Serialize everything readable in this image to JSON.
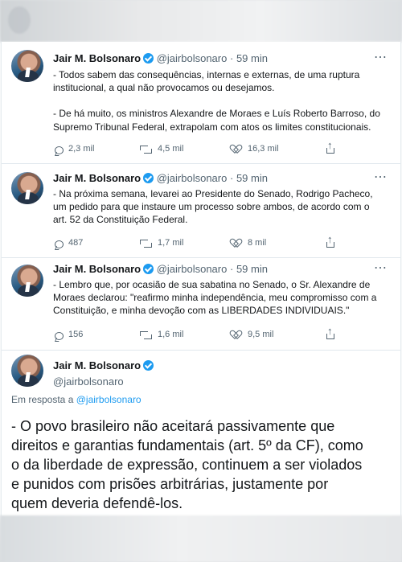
{
  "tweets": [
    {
      "author": "Jair M. Bolsonaro",
      "handle": "@jairbolsonaro",
      "separator": "·",
      "time": "59 min",
      "lines": [
        "- Todos sabem das consequências, internas e externas, de uma ruptura",
        "institucional, a qual não provocamos ou desejamos.",
        "",
        "- De há muito, os ministros Alexandre de Moraes e Luís Roberto Barroso, do",
        "Supremo Tribunal Federal, extrapolam com atos os limites constitucionais."
      ],
      "replies": "2,3 mil",
      "retweets": "4,5 mil",
      "likes": "16,3 mil"
    },
    {
      "author": "Jair M. Bolsonaro",
      "handle": "@jairbolsonaro",
      "separator": "·",
      "time": "59 min",
      "lines": [
        "- Na próxima semana, levarei ao Presidente do Senado, Rodrigo Pacheco,",
        "um pedido para que instaure um processo sobre ambos, de acordo com o",
        "art. 52 da Constituição Federal."
      ],
      "replies": "487",
      "retweets": "1,7 mil",
      "likes": "8 mil"
    },
    {
      "author": "Jair M. Bolsonaro",
      "handle": "@jairbolsonaro",
      "separator": "·",
      "time": "59 min",
      "lines": [
        "- Lembro que, por ocasião de sua sabatina no Senado, o Sr. Alexandre de",
        "Moraes declarou: \"reafirmo minha independência, meu compromisso com a",
        "Constituição, e minha devoção com as LIBERDADES INDIVIDUAIS.\""
      ],
      "replies": "156",
      "retweets": "1,6 mil",
      "likes": "9,5 mil"
    }
  ],
  "main_tweet": {
    "author": "Jair M. Bolsonaro",
    "handle": "@jairbolsonaro",
    "reply_prefix": "Em resposta a",
    "reply_handle": "@jairbolsonaro",
    "lines": [
      "- O povo brasileiro não aceitará passivamente que",
      "direitos e garantias fundamentais (art. 5º da CF), como",
      "o da liberdade de expressão, continuem a ser violados",
      "e punidos com prisões arbitrárias, justamente por",
      "quem deveria defendê-los."
    ]
  },
  "icons": {
    "options": "more-options-icon",
    "reply": "reply-icon",
    "retweet": "retweet-icon",
    "like": "like-icon",
    "share": "share-icon",
    "verified": "verified-badge-icon"
  },
  "colors": {
    "text": "#14171a",
    "muted": "#536471",
    "accent": "#1d9bf0",
    "divider": "#e1e8ed"
  }
}
